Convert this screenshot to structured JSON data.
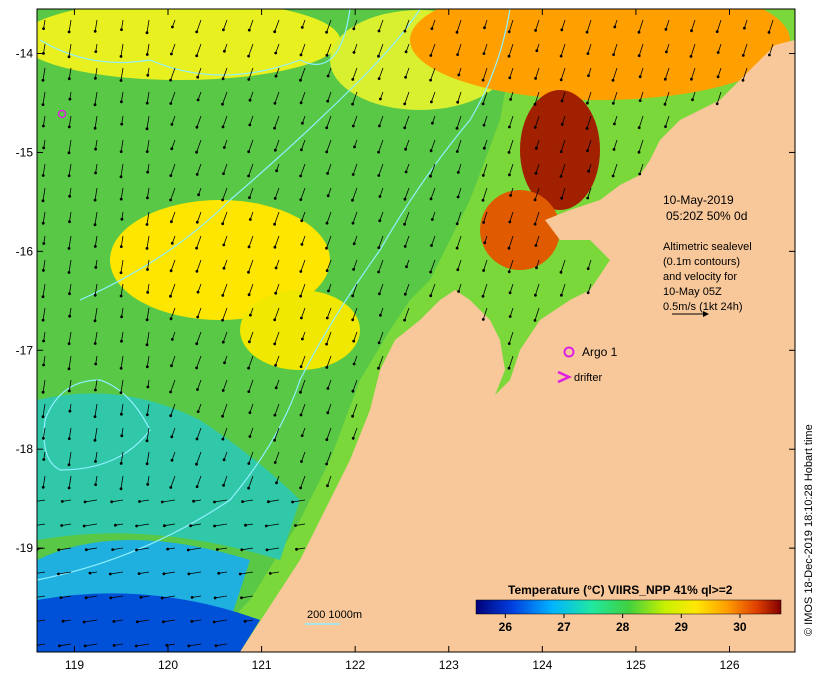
{
  "map": {
    "lon_labels": [
      "119",
      "120",
      "121",
      "122",
      "123",
      "124",
      "125",
      "126"
    ],
    "lat_labels": [
      "-14",
      "-15",
      "-16",
      "-17",
      "-18",
      "-19"
    ],
    "lon_range": [
      118.6,
      126.7
    ],
    "lat_range": [
      -13.55,
      -20.05
    ],
    "timestamp_line1": "10-May-2019",
    "timestamp_line2": "05:20Z  50% 0d",
    "altimetry_note": [
      "Altimetric sealevel",
      "(0.1m contours)",
      "and velocity for",
      "10-May 05Z",
      "0.5m/s (1kt 24h)"
    ],
    "argo_label": "Argo 1",
    "drifter_label": "drifter",
    "depth_label": "200  1000m",
    "colorbar_title": "Temperature (°C) VIIRS_NPP 41% ql>=2",
    "colorbar_ticks": [
      "26",
      "27",
      "28",
      "29",
      "30"
    ],
    "colorbar_range": [
      25.5,
      30.7
    ],
    "credit": "© IMOS 18-Dec-2019 18:10:28 Hobart time",
    "colors": {
      "land": "#f8c89a",
      "argo_marker": "#e020e0",
      "contour": "#8ff0ff",
      "frame": "#000000"
    }
  }
}
